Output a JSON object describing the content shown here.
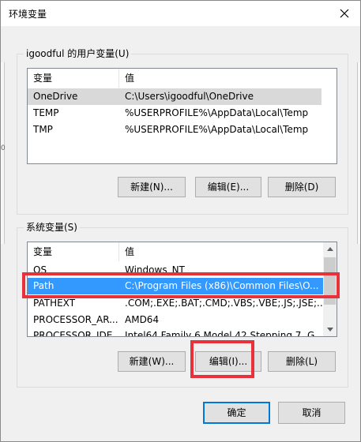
{
  "window": {
    "title": "环境变量"
  },
  "side": {
    "left_marks": [
      "",
      "",
      "0",
      ""
    ],
    "right_marks": []
  },
  "user_vars": {
    "group_label": "igoodful 的用户变量(U)",
    "columns": {
      "name": "变量",
      "value": "值"
    },
    "rows": [
      {
        "name": "OneDrive",
        "value": "C:\\Users\\igoodful\\OneDrive",
        "selected": true
      },
      {
        "name": "TEMP",
        "value": "%USERPROFILE%\\AppData\\Local\\Temp"
      },
      {
        "name": "TMP",
        "value": "%USERPROFILE%\\AppData\\Local\\Temp"
      }
    ],
    "buttons": {
      "new": "新建(N)...",
      "edit": "编辑(E)...",
      "delete": "删除(D)"
    }
  },
  "system_vars": {
    "group_label": "系统变量(S)",
    "columns": {
      "name": "变量",
      "value": "值"
    },
    "rows": [
      {
        "name": "OS",
        "value": "Windows_NT"
      },
      {
        "name": "Path",
        "value": "C:\\Program Files (x86)\\Common Files\\O...",
        "selected": true
      },
      {
        "name": "PATHEXT",
        "value": ".COM;.EXE;.BAT;.CMD;.VBS;.VBE;.JS;.JSE;..."
      },
      {
        "name": "PROCESSOR_AR...",
        "value": "AMD64"
      },
      {
        "name": "PROCESSOR_IDE...",
        "value": "Intel64 Family 6 Model 42 Stepping 7, G..."
      }
    ],
    "buttons": {
      "new": "新建(W)...",
      "edit": "编辑(I)...",
      "delete": "删除(L)"
    }
  },
  "footer": {
    "ok": "确定",
    "cancel": "取消"
  },
  "colors": {
    "highlight": "#e8313a",
    "selection": "#3399ff",
    "accent": "#0078d7"
  },
  "icons": {
    "close": "close-icon",
    "scroll_up": "chevron-up-icon",
    "scroll_down": "chevron-down-icon"
  }
}
